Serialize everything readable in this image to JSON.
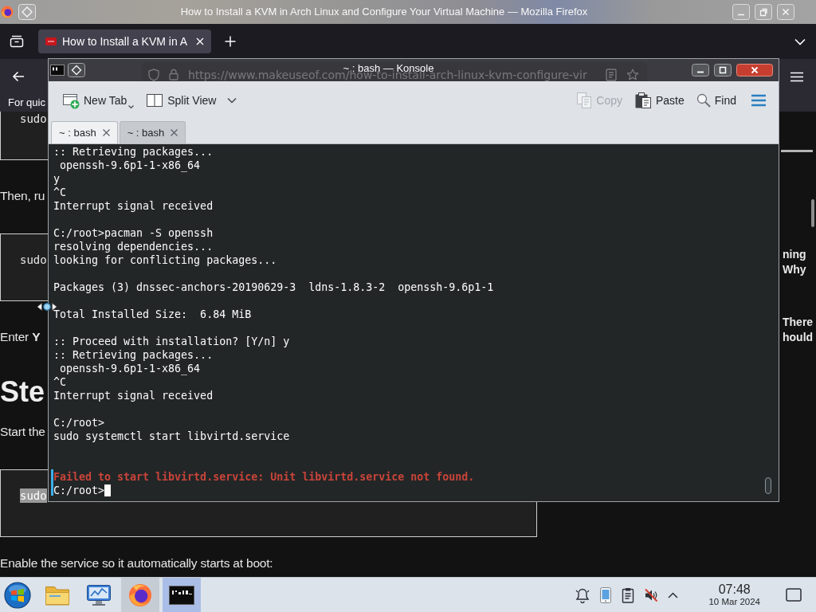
{
  "firefox": {
    "title": "How to Install a KVM in Arch Linux and Configure Your Virtual Machine — Mozilla Firefox",
    "tabs": [
      {
        "label": "How to Install a KVM in A",
        "selected": true
      }
    ],
    "url": "https://www.makeuseof.com/how-to-install-arch-linux-kvm-configure-vir",
    "notice": "For quic",
    "article": [
      {
        "kind": "code",
        "text": "sudo",
        "selected": false
      },
      {
        "kind": "paragraph",
        "text": "Then, ru"
      },
      {
        "kind": "code",
        "text": "sudo",
        "selected": false
      },
      {
        "kind": "paragraph",
        "text": "Enter **Y**"
      },
      {
        "kind": "heading",
        "text": "Ste"
      },
      {
        "kind": "paragraph",
        "text": "Start the"
      },
      {
        "kind": "code",
        "text": "sudo",
        "selected": true
      },
      {
        "kind": "paragraph",
        "text": "Enable the service so it automatically starts at boot:"
      }
    ],
    "sidebar": [
      {
        "lines": [
          "ning",
          "Why"
        ]
      },
      {
        "lines": [
          "There",
          "hould"
        ]
      }
    ]
  },
  "konsole": {
    "title": "~ : bash — Konsole",
    "toolbar": {
      "left": [
        {
          "kind": "newtab",
          "label": "New Tab",
          "disabled": false,
          "dropdown": true
        },
        {
          "kind": "split",
          "label": "Split View",
          "disabled": false,
          "dropdown": true
        }
      ],
      "right": [
        {
          "kind": "copy",
          "label": "Copy",
          "disabled": true,
          "dropdown": false
        },
        {
          "kind": "paste",
          "label": "Paste",
          "disabled": false,
          "dropdown": false
        },
        {
          "kind": "find",
          "label": "Find",
          "disabled": false,
          "dropdown": false
        }
      ]
    },
    "tabs": [
      {
        "label": "~ : bash",
        "selected": true
      },
      {
        "label": "~ : bash",
        "selected": false
      }
    ],
    "lines": [
      {
        "kind": "text",
        "text": ":: Retrieving packages..."
      },
      {
        "kind": "text",
        "text": " openssh-9.6p1-1-x86_64"
      },
      {
        "kind": "text",
        "text": "y"
      },
      {
        "kind": "text",
        "text": "^C"
      },
      {
        "kind": "text",
        "text": "Interrupt signal received"
      },
      {
        "kind": "blank"
      },
      {
        "kind": "text",
        "text": "C:/root>pacman -S openssh"
      },
      {
        "kind": "text",
        "text": "resolving dependencies..."
      },
      {
        "kind": "text",
        "text": "looking for conflicting packages..."
      },
      {
        "kind": "blank"
      },
      {
        "kind": "text",
        "text": "Packages (3) dnssec-anchors-20190629-3  ldns-1.8.3-2  openssh-9.6p1-1"
      },
      {
        "kind": "blank"
      },
      {
        "kind": "text",
        "text": "Total Installed Size:  6.84 MiB"
      },
      {
        "kind": "blank"
      },
      {
        "kind": "text",
        "text": ":: Proceed with installation? [Y/n] y"
      },
      {
        "kind": "text",
        "text": ":: Retrieving packages..."
      },
      {
        "kind": "text",
        "text": " openssh-9.6p1-1-x86_64"
      },
      {
        "kind": "text",
        "text": "^C"
      },
      {
        "kind": "text",
        "text": "Interrupt signal received"
      },
      {
        "kind": "blank"
      },
      {
        "kind": "text",
        "text": "C:/root>"
      },
      {
        "kind": "text",
        "text": "sudo systemctl start libvirtd.service"
      },
      {
        "kind": "blank"
      },
      {
        "kind": "blank"
      },
      {
        "kind": "error",
        "text": "Failed to start libvirtd.service: Unit libvirtd.service not found."
      },
      {
        "kind": "prompt",
        "text": "C:/root>",
        "cursor": true
      }
    ]
  },
  "taskbar": {
    "apps": [
      {
        "kind": "start",
        "open": false,
        "active": false
      },
      {
        "kind": "files",
        "open": false,
        "active": false
      },
      {
        "kind": "monitor",
        "open": false,
        "active": false
      },
      {
        "kind": "browser",
        "open": true,
        "active": false
      },
      {
        "kind": "terminal",
        "open": true,
        "active": true
      }
    ],
    "time": "07:48",
    "date": "10 Mar 2024"
  }
}
